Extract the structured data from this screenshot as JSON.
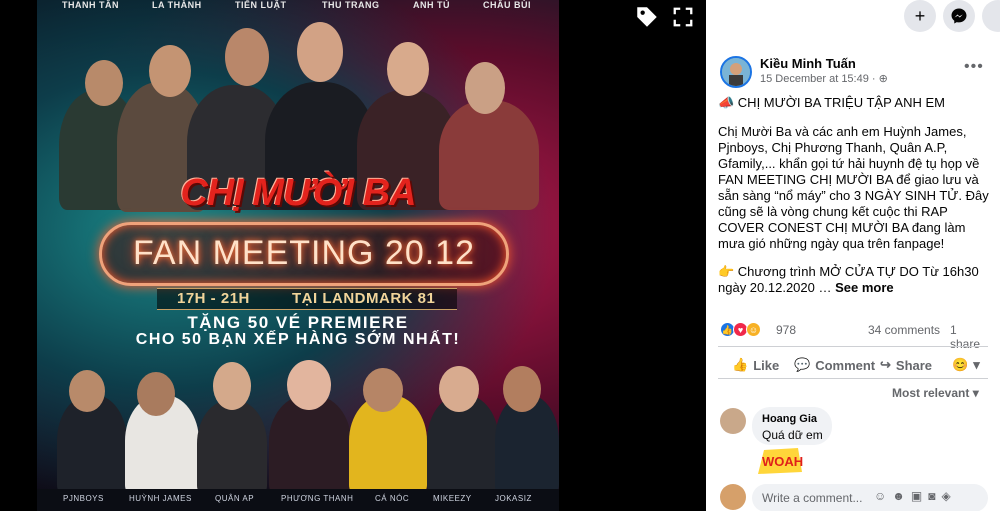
{
  "poster": {
    "cast_top": [
      "THANH TÂN",
      "LA THÀNH",
      "TIẾN LUẬT",
      "THU TRANG",
      "ANH TÚ",
      "CHÂU BÙI"
    ],
    "title": "CHỊ MƯỜI BA",
    "event": "FAN MEETING 20.12",
    "time": "17H - 21H",
    "place": "TẠI LANDMARK 81",
    "prize_line1": "TẶNG 50 VÉ PREMIERE",
    "prize_line2": "CHO 50 BẠN XẾP HÀNG SỚM NHẤT!",
    "cast_bottom": [
      "PJNBOYS",
      "HUỲNH JAMES",
      "QUÂN AP",
      "PHƯƠNG THANH",
      "CÁ NÓC",
      "MIKEEZY",
      "JOKASIZ"
    ]
  },
  "viewer_icons": {
    "tag": "tag-icon",
    "fullscreen": "fullscreen-icon"
  },
  "top_buttons": {
    "plus": "+",
    "messenger": "messenger-icon"
  },
  "post": {
    "author": "Kiều Minh Tuấn",
    "date": "15 December at 15:49 · ",
    "headline": "📣 CHỊ MƯỜI BA TRIỆU TẬP ANH EM",
    "body1": "Chị Mười Ba và các anh em Huỳnh James, Pjnboys, Chị Phương Thanh, Quân A.P, Gfamily,... khẩn gọi tứ hải huynh đệ tụ họp về FAN MEETING CHỊ MƯỜI BA để giao lưu và sẵn sàng “nổ máy” cho 3 NGÀY SINH TỬ. Đây cũng sẽ là vòng chung kết cuộc thi RAP COVER CONEST CHỊ MƯỜI BA đang làm mưa gió những ngày qua trên fanpage!",
    "body2": "👉 Chương trình MỞ CỬA TỰ DO Từ 16h30 ngày 20.12.2020 … ",
    "see_more": "See more",
    "reactions": "978",
    "comments": "34 comments",
    "shares": "1 share",
    "like_label": "Like",
    "comment_label": "Comment",
    "share_label": "Share",
    "sort_label": "Most relevant ▾"
  },
  "comment": {
    "name": "Hoang Gia",
    "text": "Quá dữ em",
    "sticker_text": "WOAH"
  },
  "write": {
    "placeholder": "Write a comment..."
  },
  "colors": {
    "accent": "#1b74e4",
    "panel_bg": "#ffffff",
    "secondary_text": "#65676b"
  }
}
